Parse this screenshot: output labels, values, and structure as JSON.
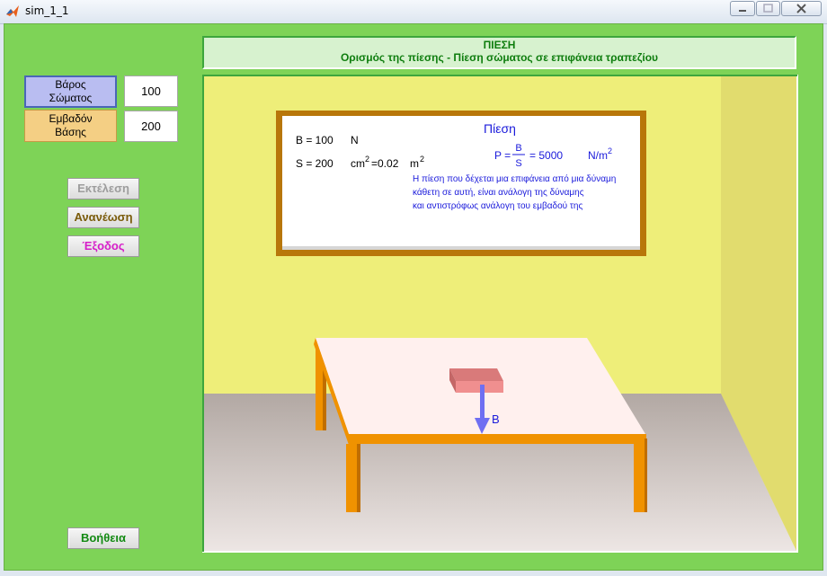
{
  "window": {
    "title": "sim_1_1"
  },
  "colors": {
    "panel_green": "#7ed357",
    "header_text": "#0e7d0e",
    "board_text": "#1a1adb",
    "arrow": "#6f6ff2",
    "table_top": "#fff0ee",
    "table_legs": "#f09200"
  },
  "header": {
    "line1": "ΠΙΕΣΗ",
    "line2": "Ορισμός της πίεσης - Πίεση σώματος σε επιφάνεια τραπεζίου"
  },
  "inputs": {
    "weight": {
      "label_line1": "Βάρος",
      "label_line2": "Σώματος",
      "value": "100"
    },
    "area": {
      "label_line1": "Εμβαδόν",
      "label_line2": "Βάσης",
      "value": "200"
    }
  },
  "buttons": {
    "run": "Εκτέλεση",
    "refresh": "Ανανέωση",
    "exit": "Έξοδος",
    "help": "Βοήθεια"
  },
  "board": {
    "title": "Πίεση",
    "b_line": "B = 100",
    "b_unit": "N",
    "s_line": "S = 200",
    "s_unit_cm": "cm",
    "s_unit_sup": "2",
    "s_convert": "=0.02",
    "s_unit_m": "m",
    "s_unit_m_sup": "2",
    "formula_p": "P =",
    "formula_num": "B",
    "formula_den": "S",
    "formula_result": "= 5000",
    "formula_unit": "N/m",
    "formula_unit_sup": "2",
    "desc_line1": "Η πίεση που δέχεται μια επιφάνεια από μια δύναμη",
    "desc_line2": "κάθετη σε αυτή, είναι ανάλογη της δύναμης",
    "desc_line3": "και αντιστρόφως ανάλογη του εμβαδού της"
  },
  "scene": {
    "force_label": "B"
  }
}
